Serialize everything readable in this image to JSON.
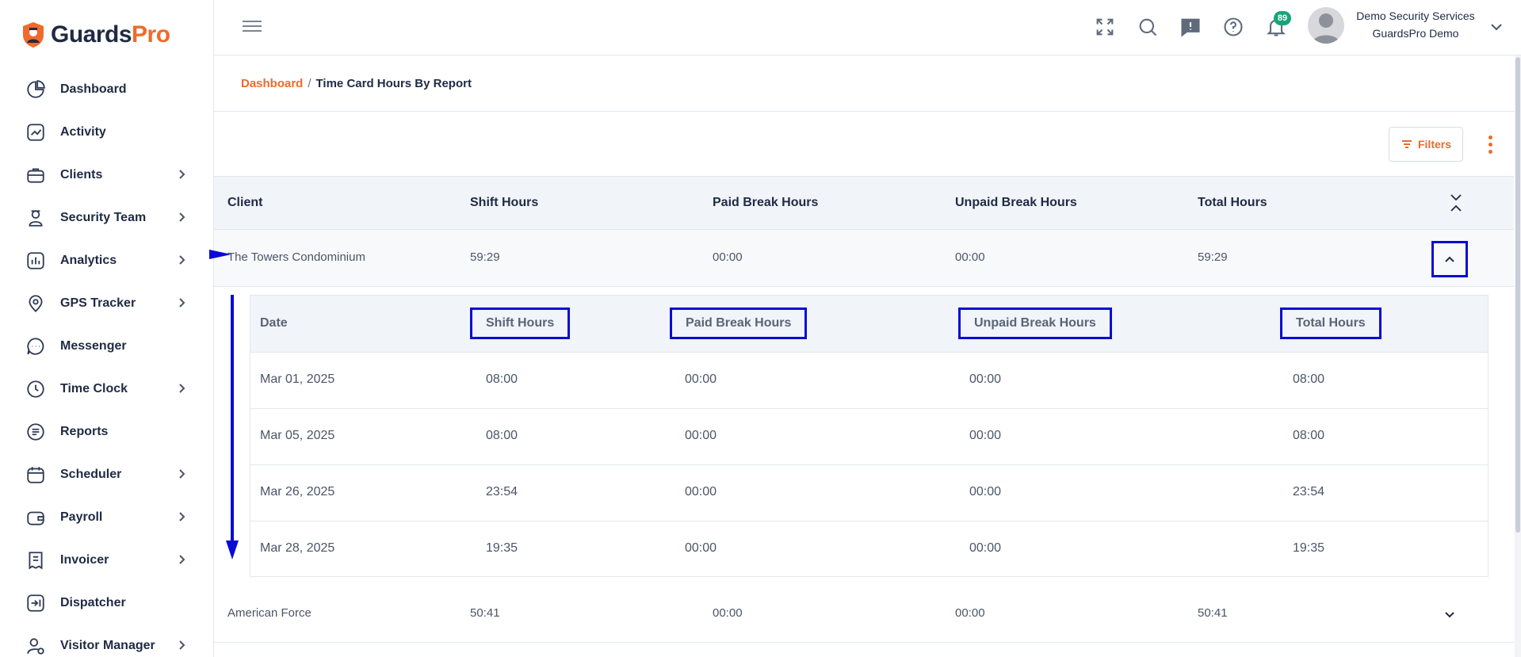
{
  "app": {
    "logo_part1": "Guards",
    "logo_part2": "Pro",
    "accent": "#ef6a2b",
    "annotation_color": "#0a0ad6"
  },
  "sidebar": {
    "items": [
      {
        "label": "Dashboard",
        "icon": "dashboard-icon",
        "has_children": false
      },
      {
        "label": "Activity",
        "icon": "activity-icon",
        "has_children": false
      },
      {
        "label": "Clients",
        "icon": "briefcase-icon",
        "has_children": true
      },
      {
        "label": "Security Team",
        "icon": "guard-icon",
        "has_children": true
      },
      {
        "label": "Analytics",
        "icon": "analytics-icon",
        "has_children": true
      },
      {
        "label": "GPS Tracker",
        "icon": "location-pin-icon",
        "has_children": true
      },
      {
        "label": "Messenger",
        "icon": "chat-icon",
        "has_children": false
      },
      {
        "label": "Time Clock",
        "icon": "clock-icon",
        "has_children": true
      },
      {
        "label": "Reports",
        "icon": "report-icon",
        "has_children": false
      },
      {
        "label": "Scheduler",
        "icon": "calendar-icon",
        "has_children": true
      },
      {
        "label": "Payroll",
        "icon": "wallet-icon",
        "has_children": true
      },
      {
        "label": "Invoicer",
        "icon": "invoice-icon",
        "has_children": true
      },
      {
        "label": "Dispatcher",
        "icon": "dispatch-icon",
        "has_children": false
      },
      {
        "label": "Visitor Manager",
        "icon": "visitor-icon",
        "has_children": true
      }
    ]
  },
  "header": {
    "notifications_count": "89",
    "user_name": "Demo Security Services",
    "user_org": "GuardsPro Demo"
  },
  "breadcrumb": {
    "home": "Dashboard",
    "separator": "/",
    "current": "Time Card Hours By Report"
  },
  "toolbar": {
    "filters_label": "Filters"
  },
  "table": {
    "columns": [
      "Client",
      "Shift Hours",
      "Paid Break Hours",
      "Unpaid Break Hours",
      "Total Hours"
    ],
    "rows": [
      {
        "client": "The Towers Condominium",
        "shift": "59:29",
        "paid": "00:00",
        "unpaid": "00:00",
        "total": "59:29",
        "expanded": true
      },
      {
        "client": "American Force",
        "shift": "50:41",
        "paid": "00:00",
        "unpaid": "00:00",
        "total": "50:41",
        "expanded": false
      }
    ]
  },
  "subtable": {
    "columns": [
      "Date",
      "Shift Hours",
      "Paid Break Hours",
      "Unpaid Break Hours",
      "Total Hours"
    ],
    "rows": [
      {
        "date": "Mar 01, 2025",
        "shift": "08:00",
        "paid": "00:00",
        "unpaid": "00:00",
        "total": "08:00"
      },
      {
        "date": "Mar 05, 2025",
        "shift": "08:00",
        "paid": "00:00",
        "unpaid": "00:00",
        "total": "08:00"
      },
      {
        "date": "Mar 26, 2025",
        "shift": "23:54",
        "paid": "00:00",
        "unpaid": "00:00",
        "total": "23:54"
      },
      {
        "date": "Mar 28, 2025",
        "shift": "19:35",
        "paid": "00:00",
        "unpaid": "00:00",
        "total": "19:35"
      }
    ]
  }
}
